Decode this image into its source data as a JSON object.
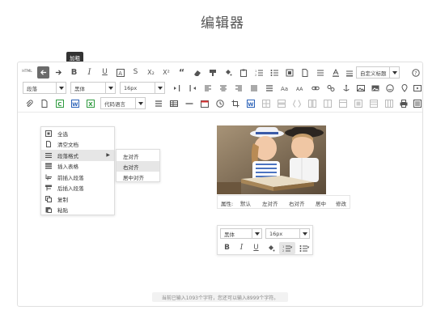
{
  "page_title": "编辑器",
  "tooltip": "加粗",
  "toolbar": {
    "html_label": "HTML",
    "bold": "B",
    "italic": "I",
    "underline": "U",
    "strike": "S",
    "sub": "X₂",
    "sup": "X²",
    "quote": "“",
    "custom_title_select": "自定义标题",
    "paragraph_select": "段落",
    "font_select": "黑体",
    "size_select": "16px",
    "code_lang_select": "代码语言"
  },
  "context_menu": {
    "items": [
      {
        "label": "全选",
        "icon": "select-all-icon"
      },
      {
        "label": "清空文档",
        "icon": "document-icon"
      },
      {
        "label": "段落格式",
        "icon": "paragraph-icon",
        "has_submenu": true
      },
      {
        "label": "插入表格",
        "icon": "table-icon"
      },
      {
        "label": "前插入段落",
        "icon": "insert-before-icon"
      },
      {
        "label": "后插入段落",
        "icon": "insert-after-icon"
      },
      {
        "label": "复制",
        "icon": "copy-icon"
      },
      {
        "label": "粘贴",
        "icon": "paste-icon"
      }
    ]
  },
  "submenu": {
    "items": [
      "左对齐",
      "右对齐",
      "居中对齐"
    ]
  },
  "image_toolbar": {
    "label": "属性:",
    "options": [
      "默认",
      "左对齐",
      "右对齐",
      "居中",
      "修改"
    ]
  },
  "format_popup": {
    "font": "黑体",
    "size": "16px",
    "bold": "B",
    "italic": "I",
    "underline": "U"
  },
  "status_text": "当前已输入1093个字符，您还可以输入8999个字符。",
  "colors": {
    "active_button": "#6b6b6b",
    "excel_green": "#2e9b3f",
    "word_blue": "#2b62b8",
    "photo_bg": "#8a7a62"
  }
}
